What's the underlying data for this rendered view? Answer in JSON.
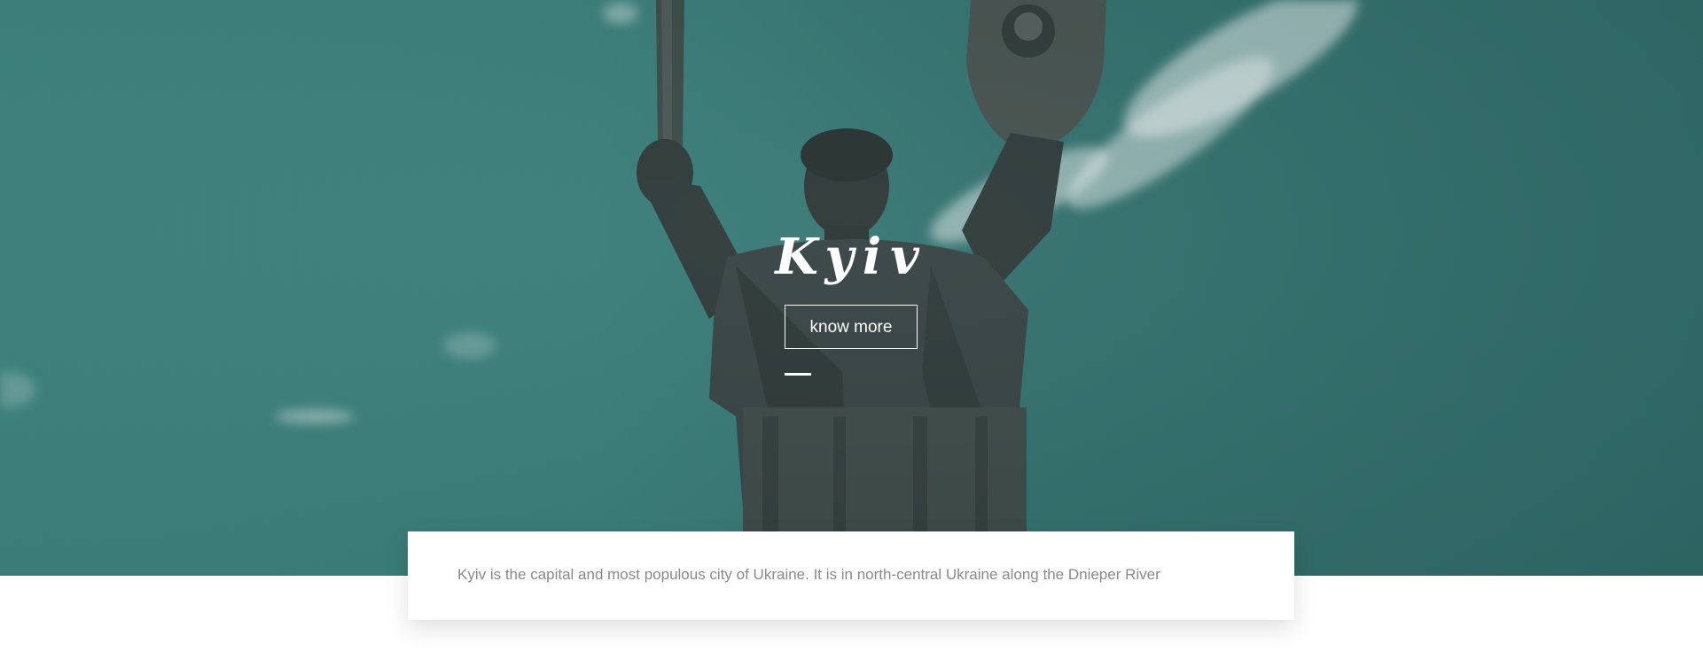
{
  "hero": {
    "title": "Kyiv",
    "button_label": "know more",
    "overlay_color": "#3a7f7b"
  },
  "info": {
    "text": "Kyiv is the capital and most populous city of Ukraine. It is in north-central Ukraine along the Dnieper River"
  },
  "icons": {
    "statue": "motherland-monument-image"
  }
}
